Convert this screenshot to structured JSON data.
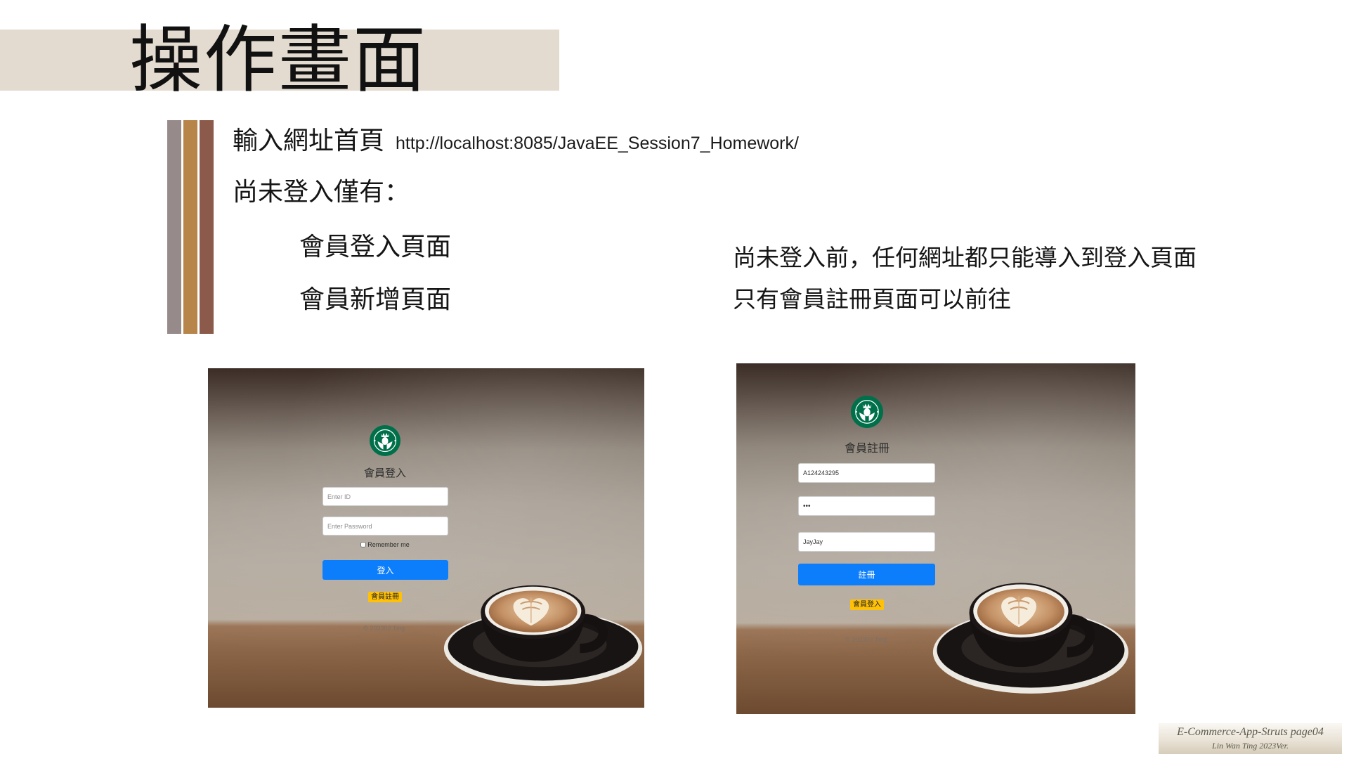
{
  "slide": {
    "title": "操作畫面",
    "line1_label": "輸入網址首頁",
    "line1_url": "http://localhost:8085/JavaEE_Session7_Homework/",
    "line2": "尚未登入僅有：",
    "list": [
      "會員登入頁面",
      "會員新增頁面"
    ],
    "note": [
      "尚未登入前，任何網址都只能導入到登入頁面",
      "只有會員註冊頁面可以前往"
    ],
    "footer": {
      "line1": "E-Commerce-App-Struts page04",
      "line2": "Lin Wan Ting 2023Ver."
    }
  },
  "login_screen": {
    "logo_icon": "starbucks-logo",
    "heading": "會員登入",
    "id_placeholder": "Enter ID",
    "password_placeholder": "Enter Password",
    "remember_label": "Remember me",
    "remember_checked": false,
    "submit_label": "登入",
    "register_link": "會員註冊",
    "copyright": "© 202302 Ting."
  },
  "register_screen": {
    "logo_icon": "starbucks-logo",
    "heading": "會員註冊",
    "fields": [
      "A124243295",
      "•••",
      "JayJay"
    ],
    "submit_label": "註冊",
    "login_link": "會員登入",
    "copyright": "© 202302 Ting."
  },
  "colors": {
    "banner": "#e3dbd0",
    "bar_gray": "#968b8a",
    "bar_gold": "#b7844a",
    "bar_brown": "#8c5a4a",
    "primary_button": "#0d7efb",
    "link_badge": "#ffc107",
    "logo_green": "#00704a"
  }
}
